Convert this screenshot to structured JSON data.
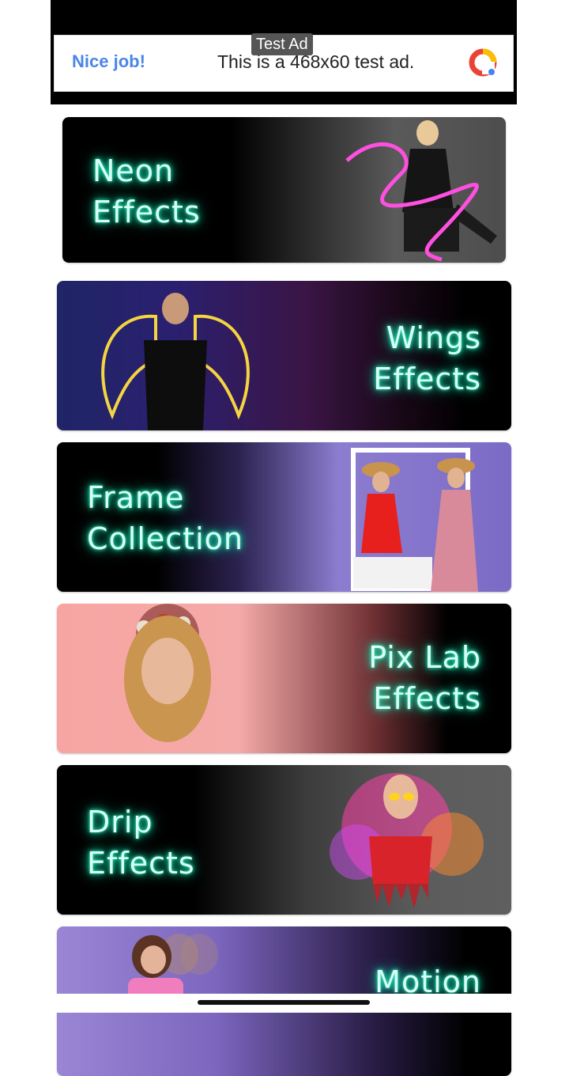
{
  "ad": {
    "tag": "Test Ad",
    "nice": "Nice job!",
    "text": "This is a 468x60 test ad.",
    "logo_icon": "ad-choices-logo-icon"
  },
  "cards": [
    {
      "line1": "Neon",
      "line2": "Effects"
    },
    {
      "line1": "Wings",
      "line2": "Effects"
    },
    {
      "line1": "Frame",
      "line2": "Collection"
    },
    {
      "line1": "Pix Lab",
      "line2": "Effects"
    },
    {
      "line1": "Drip",
      "line2": "Effects"
    },
    {
      "line1": "Motion",
      "line2": ""
    }
  ],
  "colors": {
    "neon_text": "#d8fff4",
    "neon_glow": "#13e0ae",
    "ad_link": "#4a86e8"
  }
}
